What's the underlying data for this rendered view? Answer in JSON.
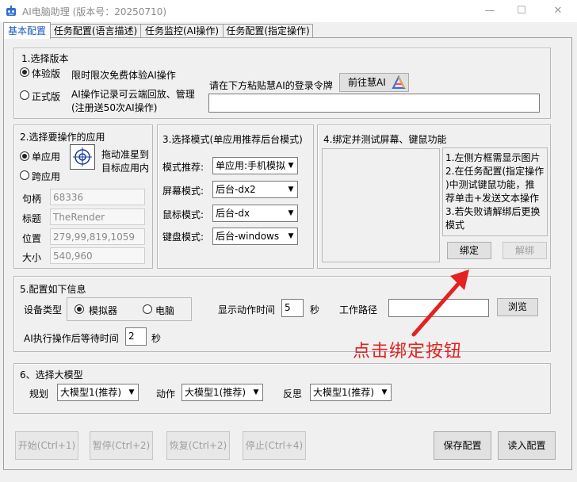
{
  "window": {
    "title": "AI电脑助理 (版本号：20250710)",
    "controls": {
      "minimize": "—",
      "maximize": "☐",
      "close": "✕"
    }
  },
  "tabs": [
    "基本配置",
    "任务配置(语言描述)",
    "任务监控(AI操作)",
    "任务配置(指定操作)"
  ],
  "version": {
    "header": "1.选择版本",
    "trial": {
      "label": "体验版",
      "desc": "限时限次免费体验AI操作",
      "selected": true
    },
    "pro": {
      "label": "正式版",
      "desc_line1": "AI操作记录可云端回放、管理",
      "desc_line2": "(注册送50次AI操作)",
      "selected": false
    },
    "token_label": "请在下方粘贴慧AI的登录令牌",
    "goto_button": "前往慧AI",
    "token_value": ""
  },
  "app": {
    "header": "2.选择要操作的应用",
    "single": {
      "label": "单应用",
      "selected": true
    },
    "cross": {
      "label": "跨应用",
      "selected": false
    },
    "drag_hint_line1": "拖动准星到",
    "drag_hint_line2": "目标应用内",
    "fields": [
      {
        "label": "句柄",
        "value": "68336"
      },
      {
        "label": "标题",
        "value": "TheRender"
      },
      {
        "label": "位置",
        "value": "279,99,819,1059"
      },
      {
        "label": "大小",
        "value": "540,960"
      }
    ]
  },
  "mode": {
    "header": "3.选择模式(单应用推荐后台模式)",
    "rows": [
      {
        "label": "模式推荐:",
        "value": "单应用:手机模拟"
      },
      {
        "label": "屏幕模式:",
        "value": "后台-dx2"
      },
      {
        "label": "鼠标模式:",
        "value": "后台-dx"
      },
      {
        "label": "键盘模式:",
        "value": "后台-windows"
      }
    ]
  },
  "bind": {
    "header": "4.绑定并测试屏幕、键鼠功能",
    "info_lines": [
      "1.左侧方框需显示图片",
      "2.在任务配置(指定操作",
      ")中测试键鼠功能，推",
      "荐单击+发送文本操作",
      "3.若失败请解绑后更换",
      "模式"
    ],
    "bind_button": "绑定",
    "unbind_button": "解绑"
  },
  "config": {
    "header": "5.配置如下信息",
    "device_label": "设备类型",
    "emulator": {
      "label": "模拟器",
      "selected": true
    },
    "pc": {
      "label": "电脑",
      "selected": false
    },
    "action_time_label": "显示动作时间",
    "action_time_value": "5",
    "action_time_unit": "秒",
    "workpath_label": "工作路径",
    "workpath_value": "",
    "browse_button": "浏览",
    "wait_label": "AI执行操作后等待时间",
    "wait_value": "2",
    "wait_unit": "秒"
  },
  "model": {
    "header": "6、选择大模型",
    "items": [
      {
        "label": "规划",
        "value": "大模型1(推荐)"
      },
      {
        "label": "动作",
        "value": "大模型1(推荐)"
      },
      {
        "label": "反思",
        "value": "大模型1(推荐)"
      }
    ]
  },
  "footer": {
    "start": "开始(Ctrl+1)",
    "pause": "暂停(Ctrl+2)",
    "resume": "恢复(Ctrl+2)",
    "stop": "停止(Ctrl+4)",
    "save": "保存配置",
    "load": "读入配置"
  },
  "annotation": {
    "text": "点击绑定按钮",
    "color": "#e32222"
  },
  "colors": {
    "accent": "#1a56c0",
    "annotation": "#e32222"
  }
}
